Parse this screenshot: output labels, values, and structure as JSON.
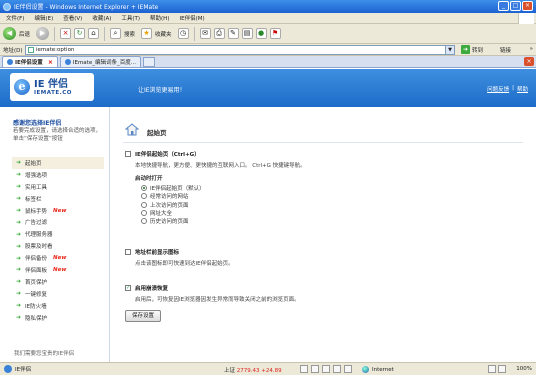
{
  "window": {
    "title": "IE伴侣设置 - Windows Internet Explorer + IEMate",
    "minimize": "_",
    "maximize": "□",
    "close": "×"
  },
  "menu": [
    "文件(F)",
    "编辑(E)",
    "查看(V)",
    "收藏(A)",
    "工具(T)",
    "帮助(H)",
    "IE伴侣(M)"
  ],
  "toolbar": {
    "back": "后退",
    "search": "搜索",
    "favorites": "收藏夹"
  },
  "address": {
    "label": "地址(D)",
    "value": "iemate:option",
    "go": "转到",
    "links": "链接"
  },
  "tabs": [
    {
      "label": "IE伴侣设置"
    },
    {
      "label": "IEmate_编辑词条_百度..."
    }
  ],
  "banner": {
    "logo_main": "IE 伴侣",
    "logo_sub": "IEMATE.CO",
    "slogan": "让IE浏览更易用！",
    "link_feedback": "问题反馈",
    "link_sep": "|",
    "link_help": "帮助"
  },
  "sidebar": {
    "title": "感谢您选择IE伴侣",
    "desc": "若要完成设置，请选择合适的选项，单击“保存设置”按钮",
    "items": [
      {
        "label": "起始页",
        "new": ""
      },
      {
        "label": "增强选项",
        "new": ""
      },
      {
        "label": "实用工具",
        "new": ""
      },
      {
        "label": "标签栏",
        "new": ""
      },
      {
        "label": "鼠标手势",
        "new": "New"
      },
      {
        "label": "广告过滤",
        "new": ""
      },
      {
        "label": "代理服务器",
        "new": ""
      },
      {
        "label": "股票及时看",
        "new": ""
      },
      {
        "label": "伴侣备份",
        "new": "New"
      },
      {
        "label": "伴侣面板",
        "new": "New"
      },
      {
        "label": "首页保护",
        "new": ""
      },
      {
        "label": "一键修复",
        "new": ""
      },
      {
        "label": "IE防火墙",
        "new": ""
      },
      {
        "label": "隐私保护",
        "new": ""
      }
    ],
    "footer": "我们需要您宝贵的IE伴侣"
  },
  "content": {
    "title": "起始页",
    "opt1_label": "IE伴侣起始页（Ctrl+G）",
    "opt1_desc": "本地快捷导航，更方便、更快捷的互联网入口。 Ctrl+G 快捷键导航。",
    "startup_title": "启动时打开",
    "startup_options": [
      {
        "label": "IE伴侣起始页（默认）",
        "selected": true
      },
      {
        "label": "经常访问的网站",
        "selected": false
      },
      {
        "label": "上次访问的页面",
        "selected": false
      },
      {
        "label": "网址大全",
        "selected": false
      },
      {
        "label": "历史访问的页面",
        "selected": false
      }
    ],
    "opt2_label": "地址栏前显示图标",
    "opt2_desc": "点击该图标即可快速到达IE伴侣起始页。",
    "opt3_label": "启用崩溃恢复",
    "opt3_desc": "启用后，可恢复因IE浏览器因发生异常而导致关闭之前的浏览页面。",
    "opt3_checked": true,
    "save": "保存设置"
  },
  "status": {
    "text": "IE伴侣",
    "stock_name": "上证",
    "stock_value": "2779.43",
    "stock_change": "+24.89",
    "zone": "Internet",
    "zoom": "100%"
  }
}
